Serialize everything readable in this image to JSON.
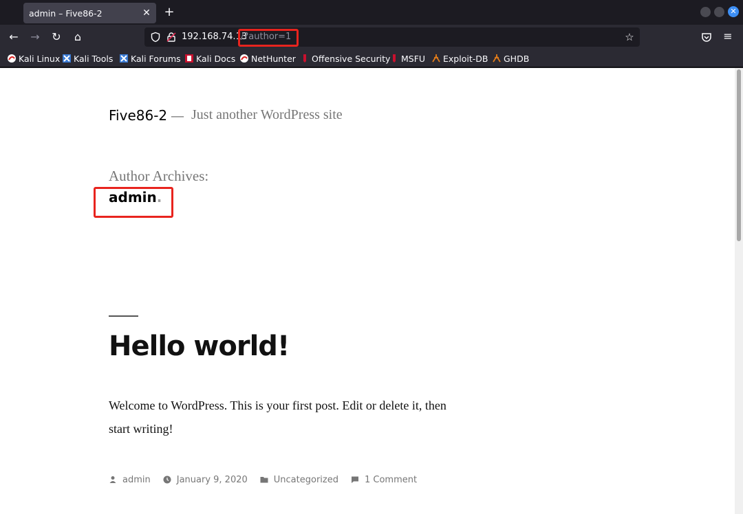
{
  "tab": {
    "title": "admin – Five86-2",
    "close": "✕",
    "new_tab": "+"
  },
  "nav": {
    "back": "←",
    "forward": "→",
    "reload": "↻",
    "home": "⌂",
    "menu": "≡",
    "star": "☆"
  },
  "url": {
    "host": "192.168.74.13",
    "path": "/?author=1"
  },
  "bookmarks": [
    {
      "label": "Kali Linux",
      "icon": "kali-icon"
    },
    {
      "label": "Kali Tools",
      "icon": "kali-tools-icon"
    },
    {
      "label": "Kali Forums",
      "icon": "kali-forums-icon"
    },
    {
      "label": "Kali Docs",
      "icon": "kali-docs-icon"
    },
    {
      "label": "NetHunter",
      "icon": "nethunter-icon"
    },
    {
      "label": "Offensive Security",
      "icon": "offsec-icon"
    },
    {
      "label": "MSFU",
      "icon": "msfu-icon"
    },
    {
      "label": "Exploit-DB",
      "icon": "exploitdb-icon"
    },
    {
      "label": "GHDB",
      "icon": "ghdb-icon"
    }
  ],
  "site": {
    "title": "Five86-2",
    "separator": "—",
    "description": "Just another WordPress site"
  },
  "archive": {
    "label": "Author Archives:",
    "name": "admin",
    "dot": "."
  },
  "post": {
    "title": "Hello world!",
    "body": "Welcome to WordPress. This is your first post. Edit or delete it, then start writing!",
    "meta": {
      "author": "admin",
      "date": "January 9, 2020",
      "category": "Uncategorized",
      "comments": "1 Comment"
    }
  },
  "colors": {
    "highlight": "#e8241e",
    "toolbar": "#2b2a33",
    "tabstrip": "#1c1b22"
  }
}
